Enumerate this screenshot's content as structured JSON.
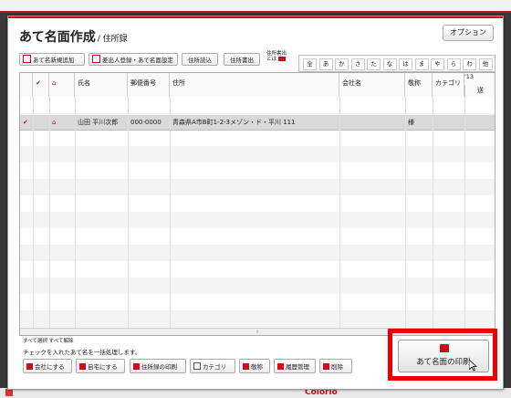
{
  "bg": {
    "bottom_text": "Colorio"
  },
  "dialog": {
    "title": "あて名面作成",
    "subtitle": "/ 住所録",
    "option_button": "オプション"
  },
  "toolbar": {
    "new_address": "あて名新規追加",
    "sender_settings": "差出人登録・あて名面設定",
    "import_addresses": "住所読込",
    "export_addresses": "住所書出",
    "export_note_1": "住所書出",
    "export_note_2": "とは"
  },
  "kana_index": [
    "全",
    "あ",
    "か",
    "さ",
    "た",
    "な",
    "は",
    "ま",
    "や",
    "ら",
    "わ",
    "他"
  ],
  "table": {
    "year": "'13",
    "sent_col": "送",
    "headers": [
      "",
      "",
      "氏名",
      "郵便番号",
      "住所",
      "会社名",
      "敬称",
      "カテゴリ"
    ],
    "rows": [
      {
        "check": "✔",
        "name": "山田 平川次郎",
        "zip": "000-0000",
        "address": "青森県A市B町1-2-3メゾン・ド・平川 111",
        "company": "",
        "honorific": "様",
        "category": ""
      }
    ]
  },
  "footer": {
    "select_all": "すべて選択",
    "deselect_all": "すべて解除",
    "info": "チェックを入れたあて名を一括処理します。",
    "buttons": {
      "company": "会社にする",
      "home": "自宅にする",
      "print_address_book": "住所録の印刷",
      "category": "カテゴリ",
      "honorific": "敬称",
      "history": "履歴管理",
      "delete": "削除"
    },
    "print_button": "あて名面の印刷"
  }
}
